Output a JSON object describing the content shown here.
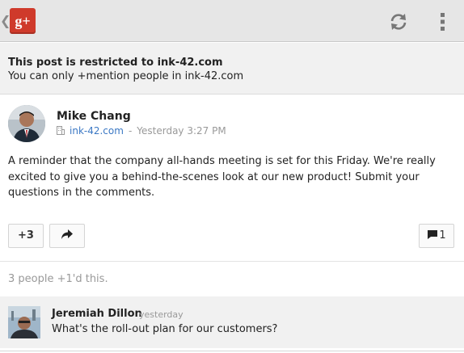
{
  "app": {
    "logo_text": "g+",
    "brand_color": "#cf3a2b"
  },
  "toolbar": {
    "back_icon": "chevron-left-icon",
    "refresh_icon": "refresh-icon",
    "menu_icon": "overflow-menu-icon"
  },
  "notice": {
    "title": "This post is restricted to ink-42.com",
    "subtitle": "You can only +mention people in ink-42.com"
  },
  "post": {
    "author": "Mike Chang",
    "domain": "ink-42.com",
    "separator": "-",
    "timestamp": "Yesterday 3:27 PM",
    "body": "A reminder that the company all-hands meeting is set for this Friday. We're really excited to give you a behind-the-scenes look at our new product! Submit your questions in the comments.",
    "plus_label": "+3",
    "comment_count": "1",
    "plus_ones_text": "3 people +1'd this."
  },
  "comment": {
    "author": "Jeremiah Dillon",
    "time": "yesterday",
    "text": "What's the roll-out plan for our customers?"
  }
}
